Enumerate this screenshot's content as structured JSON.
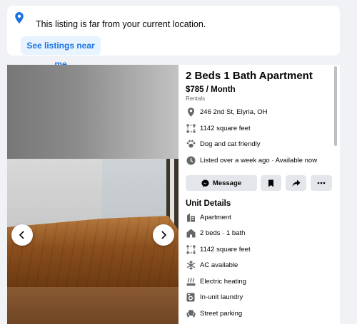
{
  "notice": {
    "icon": "location-pin-icon",
    "message": "This listing is far from your current location.",
    "button_label": "See listings near me",
    "accent": "#1b74e4"
  },
  "gallery": {
    "prev_icon": "chevron-left-icon",
    "next_icon": "chevron-right-icon"
  },
  "listing": {
    "title": "2 Beds 1 Bath Apartment",
    "price": "$785 / Month",
    "category": "Rentals",
    "info": [
      {
        "icon": "location-pin-icon",
        "text": "246 2nd St, Elyria, OH"
      },
      {
        "icon": "square-feet-icon",
        "text": "1142 square feet"
      },
      {
        "icon": "paw-icon",
        "text": "Dog and cat friendly"
      },
      {
        "icon": "clock-icon",
        "text": "Listed over a week ago · Available now"
      }
    ],
    "actions": {
      "message_label": "Message",
      "message_icon": "messenger-icon",
      "save_icon": "bookmark-icon",
      "share_icon": "share-icon",
      "more_icon": "more-icon"
    }
  },
  "unit_details": {
    "heading": "Unit Details",
    "items": [
      {
        "icon": "building-icon",
        "text": "Apartment"
      },
      {
        "icon": "home-icon",
        "text": "2 beds · 1 bath"
      },
      {
        "icon": "square-feet-icon",
        "text": "1142 square feet"
      },
      {
        "icon": "snowflake-icon",
        "text": "AC available"
      },
      {
        "icon": "heating-icon",
        "text": "Electric heating"
      },
      {
        "icon": "laundry-icon",
        "text": "In-unit laundry"
      },
      {
        "icon": "car-icon",
        "text": "Street parking"
      }
    ]
  }
}
